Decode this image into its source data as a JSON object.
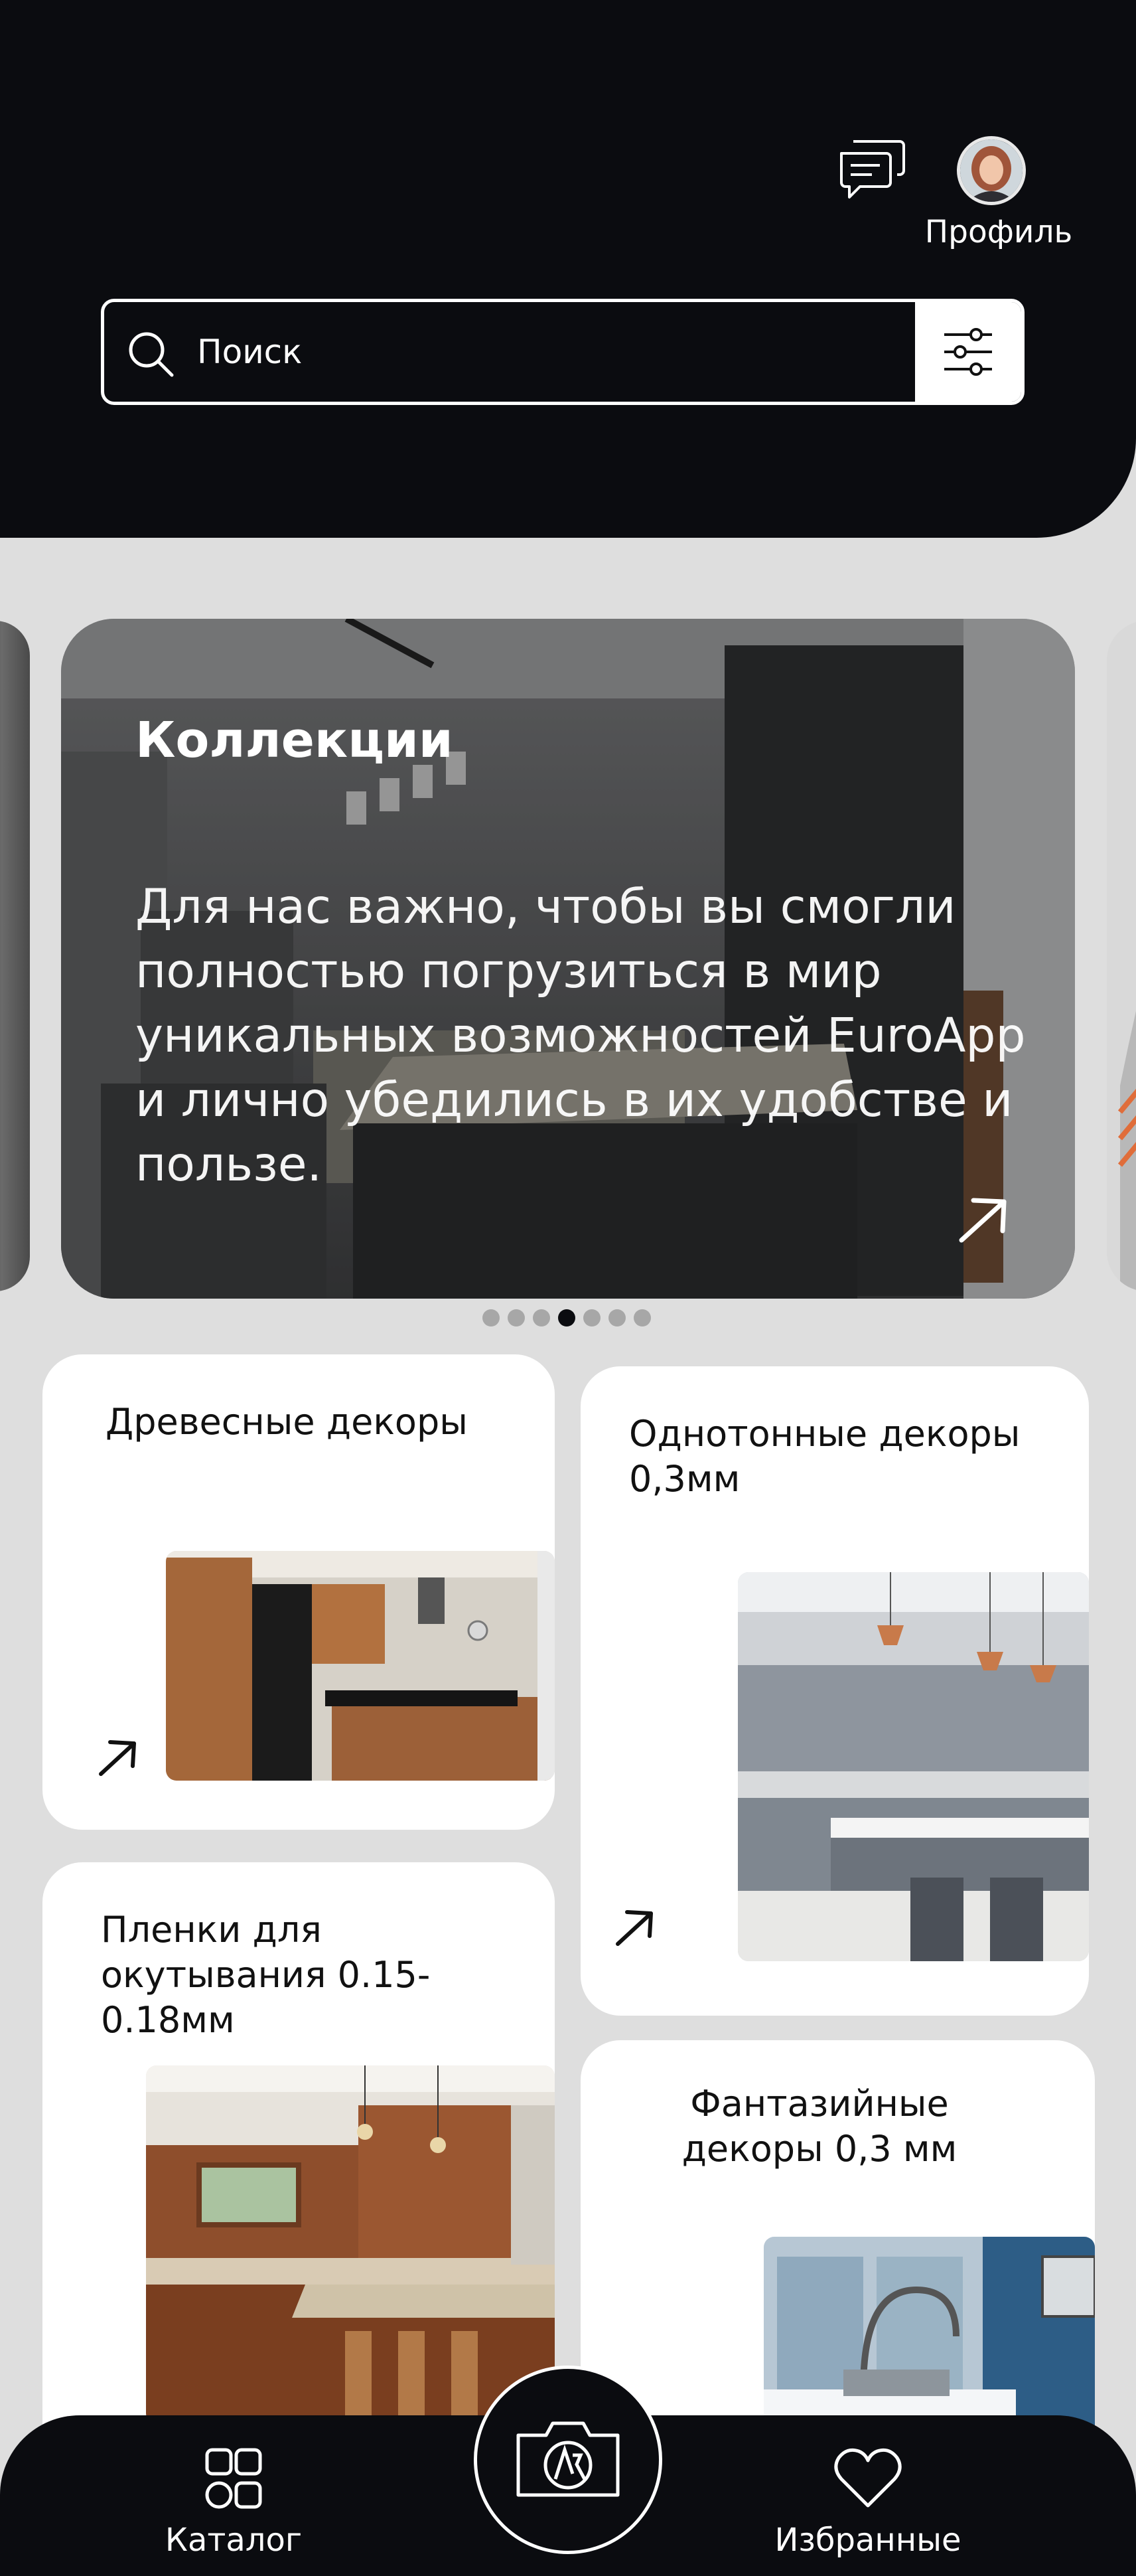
{
  "header": {
    "profile_label": "Профиль",
    "search_placeholder": "Поиск",
    "icons": [
      "chat-icon",
      "avatar",
      "search-icon",
      "filter-icon"
    ]
  },
  "carousel": {
    "title": "Коллекции",
    "text": "Для нас важно, чтобы вы смогли полностью погрузиться в мир уникальных возможностей EuroApp и лично убедились в их удобстве и пользе.",
    "page_count": 7,
    "active_page": 4
  },
  "categories": [
    {
      "title": "Древесные декоры"
    },
    {
      "title": "Однотонные декоры 0,3мм"
    },
    {
      "title": "Пленки для окутывания 0.15-0.18мм"
    },
    {
      "title": "Фантазийные декоры 0,3 мм"
    }
  ],
  "bottom_nav": {
    "catalog_label": "Каталог",
    "favorites_label": "Избранные",
    "camera_icon": "camera-ar-icon"
  },
  "colors": {
    "dark": "#0b0c10",
    "background": "#dedede",
    "card": "#ffffff",
    "dot_inactive": "#a7a7a7"
  }
}
